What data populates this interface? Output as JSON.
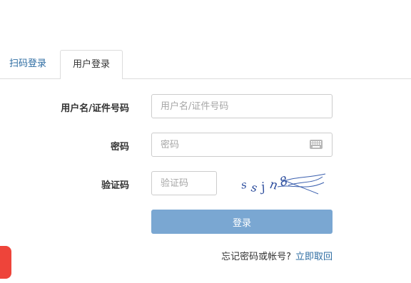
{
  "tabs": {
    "scan_label": "扫码登录",
    "user_label": "用户登录"
  },
  "form": {
    "username_label": "用户名/证件号码",
    "username_placeholder": "用户名/证件号码",
    "password_label": "密码",
    "password_placeholder": "密码",
    "captcha_label": "验证码",
    "captcha_placeholder": "验证码",
    "captcha_image_text": "ssjn8",
    "submit_label": "登录"
  },
  "help": {
    "forgot_text": "忘记密码或帐号?",
    "recover_link": "立即取回"
  },
  "colors": {
    "accent_link": "#2d6ca2",
    "submit_bg": "#7aa7d2",
    "float_red": "#ee443a"
  },
  "icons": {
    "keyboard": "keyboard-icon"
  }
}
